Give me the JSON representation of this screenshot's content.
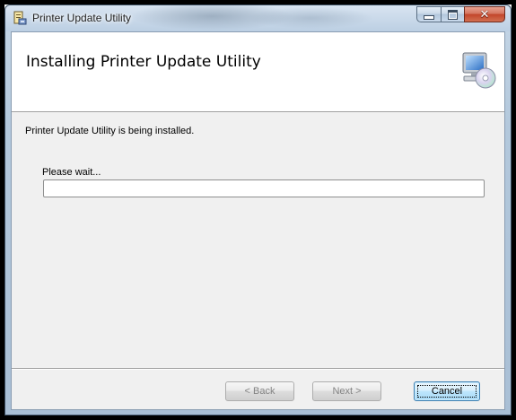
{
  "window": {
    "title": "Printer Update Utility",
    "close_symbol": "✕"
  },
  "banner": {
    "heading": "Installing Printer Update Utility",
    "icon": "computer-cd-icon"
  },
  "body": {
    "status": "Printer Update Utility is being installed.",
    "wait_label": "Please wait...",
    "progress": 0
  },
  "footer": {
    "back_label": "< Back",
    "next_label": "Next >",
    "cancel_label": "Cancel"
  },
  "colors": {
    "client_bg": "#f0f0f0",
    "banner_bg": "#ffffff",
    "cancel_border": "#3c7fb1"
  }
}
